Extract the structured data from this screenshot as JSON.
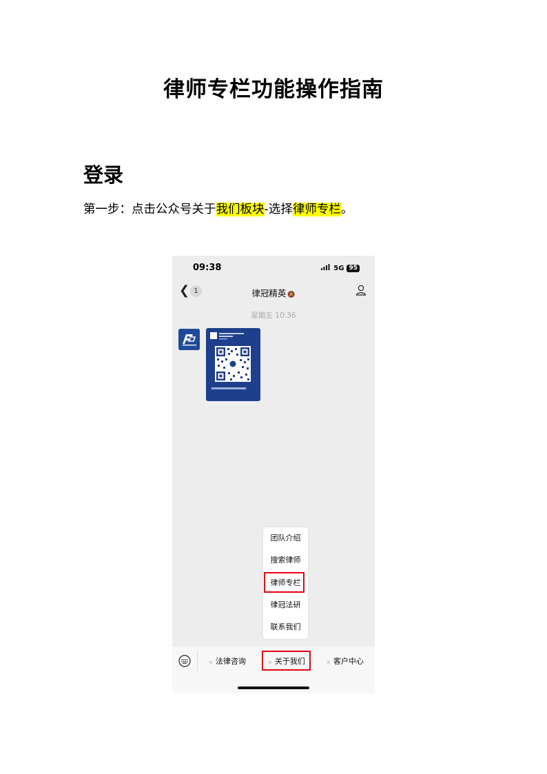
{
  "document": {
    "title": "律师专栏功能操作指南",
    "section_heading": "登录",
    "step": {
      "prefix": "第一步：点击公众号关于",
      "highlight1": "我们板块",
      "middle": "-选择",
      "highlight2": "律师专栏",
      "suffix": "。"
    }
  },
  "phone": {
    "status": {
      "time": "09:38",
      "signal": "5G",
      "battery": "95"
    },
    "nav": {
      "back_badge": "1",
      "title": "律冠精英"
    },
    "chat": {
      "timestamp": "星期五 10:36"
    },
    "popup_menu": {
      "items": [
        "团队介绍",
        "搜索律师",
        "律师专栏",
        "律冠法研",
        "联系我们"
      ]
    },
    "bottom_menu": {
      "items": [
        "法律咨询",
        "关于我们",
        "客户中心"
      ]
    }
  },
  "colors": {
    "highlight": "#ffff00",
    "annotation_red": "#e60012",
    "card_blue": "#1d3f8c"
  }
}
